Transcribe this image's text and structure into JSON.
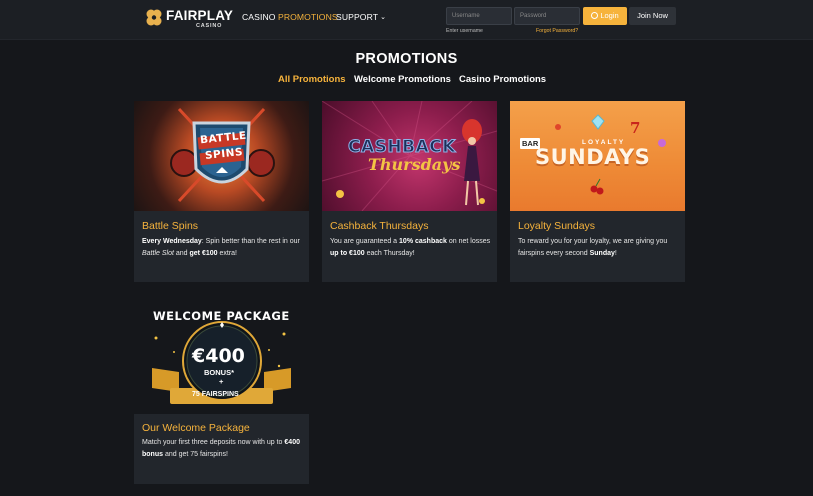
{
  "header": {
    "logo_text": "FAIRPLAY",
    "logo_sub": "CASINO",
    "nav": {
      "casino": "CASINO",
      "promotions": "PROMOTIONS",
      "support": "SUPPORT",
      "support_chevron": "⌄"
    },
    "username_placeholder": "Username",
    "password_placeholder": "Password",
    "enter_username": "Enter username",
    "forgot_password": "Forgot Password?",
    "login_label": "Login",
    "join_label": "Join Now"
  },
  "page": {
    "title": "PROMOTIONS",
    "tabs": {
      "all": "All Promotions",
      "welcome": "Welcome Promotions",
      "casino": "Casino Promotions"
    }
  },
  "cards": {
    "battle": {
      "banner_line1": "BATTLE",
      "banner_line2": "SPINS",
      "title": "Battle Spins",
      "desc_b1": "Every Wednesday",
      "desc_t1": ": Spin better than the rest in our ",
      "desc_i1": "Battle Slot",
      "desc_t2": " and ",
      "desc_b2": "get €100",
      "desc_t3": " extra!"
    },
    "cashback": {
      "banner_line1": "CASHBACK",
      "banner_line2": "Thursdays",
      "title": "Cashback Thursdays",
      "desc_t1": "You are guaranteed a ",
      "desc_b1": "10% cashback",
      "desc_t2": " on net losses ",
      "desc_b2": "up to €100",
      "desc_t3": " each Thursday!"
    },
    "loyalty": {
      "banner_small": "LOYALTY",
      "banner_big": "SUNDAYS",
      "banner_bar": "BAR",
      "banner_seven": "7",
      "title": "Loyalty Sundays",
      "desc_t1": "To reward you for your loyalty, we are giving you fairspins every second ",
      "desc_b1": "Sunday",
      "desc_t2": "!"
    },
    "welcome": {
      "banner_title": "WELCOME PACKAGE",
      "banner_amount": "€400",
      "banner_bonus": "BONUS*",
      "banner_plus": "+",
      "banner_spins": "75 FAIRSPINS",
      "title": "Our Welcome Package",
      "desc_t1": "Match your first three deposits now with up to ",
      "desc_b1": "€400 bonus",
      "desc_t2": " and get 75 fairspins!"
    }
  },
  "colors": {
    "accent": "#f6b33c",
    "background": "#15171b",
    "card": "#22262c"
  }
}
